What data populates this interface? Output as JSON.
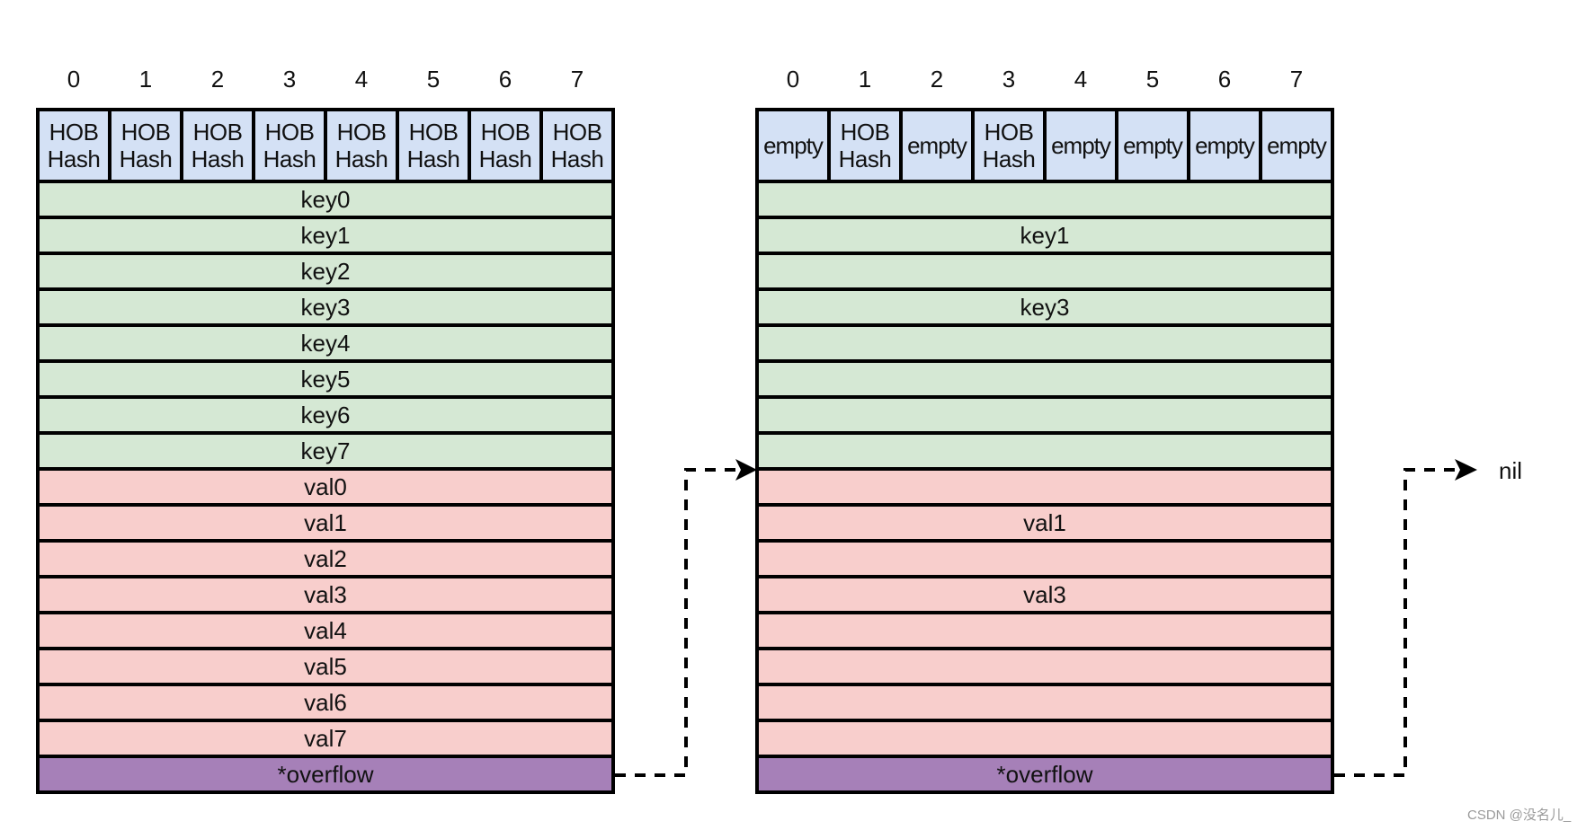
{
  "colors": {
    "tophash_fill": "#d4e1f5",
    "key_fill": "#d5e8d4",
    "val_fill": "#f8cecc",
    "overflow_fill": "#a680b8",
    "border": "#000000"
  },
  "buckets": [
    {
      "name": "bucket-full",
      "indices": [
        "0",
        "1",
        "2",
        "3",
        "4",
        "5",
        "6",
        "7"
      ],
      "tophash": [
        "HOB\nHash",
        "HOB\nHash",
        "HOB\nHash",
        "HOB\nHash",
        "HOB\nHash",
        "HOB\nHash",
        "HOB\nHash",
        "HOB\nHash"
      ],
      "keys": [
        "key0",
        "key1",
        "key2",
        "key3",
        "key4",
        "key5",
        "key6",
        "key7"
      ],
      "vals": [
        "val0",
        "val1",
        "val2",
        "val3",
        "val4",
        "val5",
        "val6",
        "val7"
      ],
      "overflow": "*overflow"
    },
    {
      "name": "bucket-overflow",
      "indices": [
        "0",
        "1",
        "2",
        "3",
        "4",
        "5",
        "6",
        "7"
      ],
      "tophash": [
        "empty",
        "HOB\nHash",
        "empty",
        "HOB\nHash",
        "empty",
        "empty",
        "empty",
        "empty"
      ],
      "keys": [
        "",
        "key1",
        "",
        "key3",
        "",
        "",
        "",
        ""
      ],
      "vals": [
        "",
        "val1",
        "",
        "val3",
        "",
        "",
        "",
        ""
      ],
      "overflow": "*overflow"
    }
  ],
  "terminal_label": "nil",
  "watermark": "CSDN @没名儿_"
}
